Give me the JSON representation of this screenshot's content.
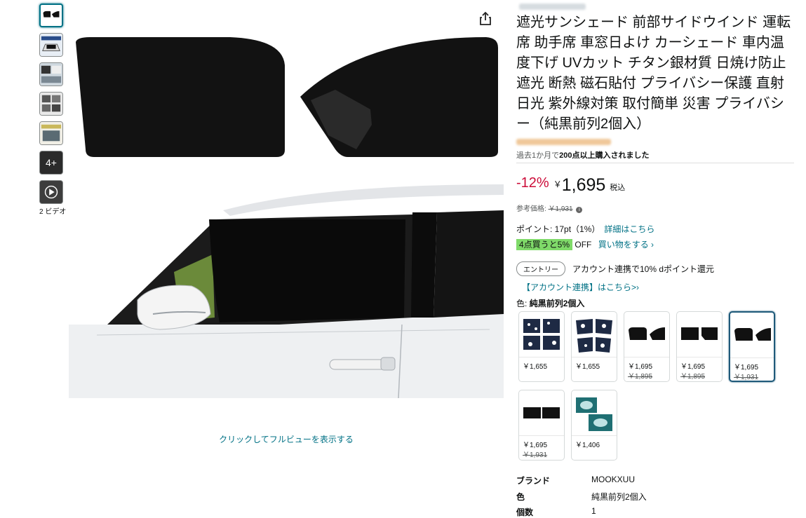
{
  "gallery": {
    "more_label": "4+",
    "video_label": "2 ビデオ",
    "full_view_label": "クリックしてフルビューを表示する"
  },
  "product": {
    "title": "遮光サンシェード 前部サイドウインド 運転席 助手席 車窓日よけ カーシェード 車内温度下げ UVカット チタン銀材質 日焼け防止 遮光 断熱 磁石貼付 プライバシー保護 直射日光 紫外線対策 取付簡単 災害 プライバシー（純黒前列2個入）",
    "purchased_prefix": "過去1か月で",
    "purchased_bold": "200点以上購入されました"
  },
  "pricing": {
    "discount": "-12%",
    "currency": "￥",
    "price": "1,695",
    "tax_label": "税込",
    "ref_label": "参考価格:",
    "ref_price": "￥1,931",
    "points_text": "ポイント: 17pt（1%）",
    "points_link": "詳細はこちら",
    "bulk_badge": "4点買うと5%",
    "bulk_off": "OFF",
    "bulk_link": "買い物をする ›"
  },
  "promo": {
    "entry_button": "エントリー",
    "entry_text": "アカウント連携で10% dポイント還元",
    "account_link": "【アカウント連携】はこちら>›"
  },
  "variation": {
    "label": "色:",
    "selected": "純黒前列2個入",
    "swatches": [
      {
        "price": "￥1,655",
        "old": "",
        "image": "patterned-four-piece"
      },
      {
        "price": "￥1,655",
        "old": "",
        "image": "patterned-two-piece"
      },
      {
        "price": "￥1,695",
        "old": "￥1,895",
        "image": "black-front-pair"
      },
      {
        "price": "￥1,695",
        "old": "￥1,895",
        "image": "black-rear-pair"
      },
      {
        "price": "￥1,695",
        "old": "￥1,931",
        "image": "black-front-pair-selected"
      },
      {
        "price": "￥1,695",
        "old": "￥1,931",
        "image": "black-rectangle-pair"
      },
      {
        "price": "￥1,406",
        "old": "",
        "image": "teal-packaging"
      }
    ]
  },
  "specs": [
    {
      "key": "ブランド",
      "value": "MOOKXUU"
    },
    {
      "key": "色",
      "value": "純黒前列2個入"
    },
    {
      "key": "個数",
      "value": "1"
    }
  ],
  "colors": {
    "link": "#007185",
    "discount": "#cc0c39",
    "bulk_badge": "#7fda69",
    "selected_border": "#1f5a7a"
  }
}
